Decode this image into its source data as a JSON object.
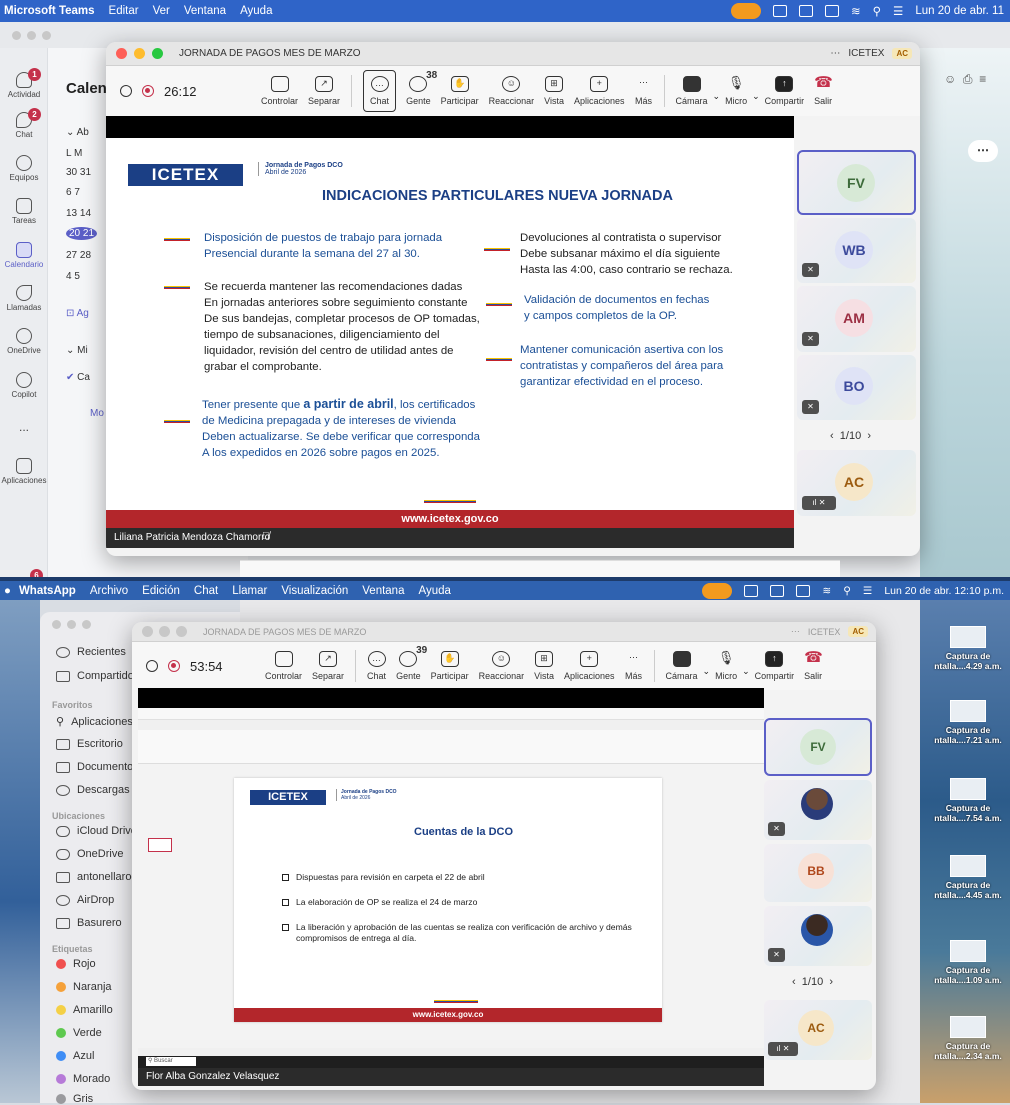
{
  "top_menubar": {
    "app": "Microsoft Teams",
    "items": [
      "Editar",
      "Ver",
      "Ventana",
      "Ayuda"
    ],
    "clock": "Lun 20 de abr. 11"
  },
  "teams": {
    "rail": [
      {
        "label": "Actividad",
        "badge": "1"
      },
      {
        "label": "Chat",
        "badge": "2"
      },
      {
        "label": "Equipos"
      },
      {
        "label": "Tareas"
      },
      {
        "label": "Calendario"
      },
      {
        "label": "Llamadas"
      },
      {
        "label": "OneDrive"
      },
      {
        "label": "Copilot"
      },
      {
        "label": "..."
      },
      {
        "label": "Aplicaciones"
      }
    ],
    "calendar_title": "Calen",
    "month_fragment": "Ab",
    "weekday_header": "L  M",
    "weeks": [
      "30  31",
      "6   7",
      "13  14",
      "20  21",
      "27  28",
      "4   5"
    ],
    "links": [
      "Ag",
      "Mi",
      "Ca",
      "Mo"
    ],
    "bottom_badge": "6"
  },
  "meeting1": {
    "title": "JORNADA DE PAGOS MES DE MARZO",
    "org": "ICETEX",
    "org_badge": "AC",
    "timer": "26:12",
    "toolbar": [
      {
        "label": "Controlar",
        "icon": "control-icon"
      },
      {
        "label": "Separar",
        "icon": "popout-icon"
      },
      {
        "label": "Chat",
        "icon": "chat-icon"
      },
      {
        "label": "Gente",
        "icon": "people-icon",
        "count": "38"
      },
      {
        "label": "Participar",
        "icon": "hand-icon"
      },
      {
        "label": "Reaccionar",
        "icon": "reaction-icon"
      },
      {
        "label": "Vista",
        "icon": "view-icon"
      },
      {
        "label": "Aplicaciones",
        "icon": "apps-icon"
      },
      {
        "label": "Más",
        "icon": "more-icon"
      }
    ],
    "camera": "Cámara",
    "mic": "Micro",
    "share": "Compartir",
    "leave": "Salir",
    "slide": {
      "logo": "ICETEX",
      "logo_sub": "Jornada de Pagos DCO",
      "logo_date": "Abril de 2026",
      "heading": "INDICACIONES PARTICULARES NUEVA JORNADA",
      "left_blocks": [
        "Disposición de puestos de trabajo para jornada\nPresencial durante la semana del 27 al 30.",
        "Se recuerda mantener las recomendaciones dadas\nEn jornadas anteriores sobre seguimiento constante\nDe sus bandejas, completar procesos de OP tomadas,\ntiempo de subsanaciones, diligenciamiento del\nliquidador, revisión del centro de utilidad antes de\ngrabar el comprobante."
      ],
      "bottom_block_pre": "Tener presente que ",
      "bottom_block_bold": "a partir de abril",
      "bottom_block_post": ", los certificados\n de Medicina prepagada y de intereses de vivienda\nDeben actualizarse.  Se debe verificar que corresponda\nA los expedidos en 2026 sobre pagos en 2025.",
      "right_blocks": [
        "Devoluciones al contratista o supervisor\nDebe subsanar máximo el día siguiente\nHasta las 4:00, caso contrario se rechaza.",
        "Validación de documentos en fechas\ny campos completos de la OP.",
        "Mantener comunicación asertiva con los\ncontratistas y compañeros del área para\ngarantizar efectividad en el proceso."
      ],
      "footer": "www.icetex.gov.co"
    },
    "presenter": "Liliana Patricia Mendoza Chamorro",
    "participants": [
      "FV",
      "WB",
      "AM",
      "BO",
      "AC"
    ],
    "pager": "1/10"
  },
  "bottom_menubar": {
    "app": "WhatsApp",
    "items": [
      "Archivo",
      "Edición",
      "Chat",
      "Llamar",
      "Visualización",
      "Ventana",
      "Ayuda"
    ],
    "clock": "Lun 20 de abr. 12:10 p.m."
  },
  "finder": {
    "top": [
      "Recientes",
      "Compartido"
    ],
    "favoritos_label": "Favoritos",
    "favoritos": [
      "Aplicaciones",
      "Escritorio",
      "Documentos",
      "Descargas"
    ],
    "ubicaciones_label": "Ubicaciones",
    "ubicaciones": [
      "iCloud Drive",
      "OneDrive",
      "antonellarocha",
      "AirDrop",
      "Basurero"
    ],
    "etiquetas_label": "Etiquetas",
    "etiquetas": [
      {
        "name": "Rojo",
        "color": "#f0504f"
      },
      {
        "name": "Naranja",
        "color": "#f5a13a"
      },
      {
        "name": "Amarillo",
        "color": "#f4d046"
      },
      {
        "name": "Verde",
        "color": "#5ec94f"
      },
      {
        "name": "Azul",
        "color": "#3f8df5"
      },
      {
        "name": "Morado",
        "color": "#b67ad8"
      },
      {
        "name": "Gris",
        "color": "#9a9a9e"
      }
    ]
  },
  "meeting2": {
    "title": "JORNADA DE PAGOS MES DE MARZO",
    "org": "ICETEX",
    "org_badge": "AC",
    "timer": "53:54",
    "people_count": "39",
    "toolbar": [
      "Controlar",
      "Separar",
      "Chat",
      "Gente",
      "Participar",
      "Reaccionar",
      "Vista",
      "Aplicaciones",
      "Más"
    ],
    "camera": "Cámara",
    "mic": "Micro",
    "share": "Compartir",
    "leave": "Salir",
    "slide": {
      "title": "Cuentas de la DCO",
      "logo": "ICETEX",
      "logo_sub": "Jornada de Pagos DCO",
      "logo_date": "Abril de 2026",
      "bullets": [
        "Dispuestas para revisión en carpeta el 22 de abril",
        "La elaboración de OP se realiza el 24 de marzo",
        "La liberación y aprobación de las cuentas se realiza con verificación de  archivo  y demás compromisos de entrega al día."
      ],
      "footer": "www.icetex.gov.co"
    },
    "presenter": "Flor Alba Gonzalez Velasquez",
    "participants": [
      "FV",
      "",
      "BB",
      "",
      "AC"
    ],
    "pager": "1/10"
  },
  "desktop_files": [
    "Captura de\nntalla....4.29 a.m.",
    "Captura de\nntalla....7.21 a.m.",
    "Captura de\nntalla....7.54 a.m.",
    "Captura de\nntalla....4.45 a.m.",
    "Captura de\nntalla....1.09 a.m.",
    "Captura de\nntalla....2.34 a.m."
  ]
}
